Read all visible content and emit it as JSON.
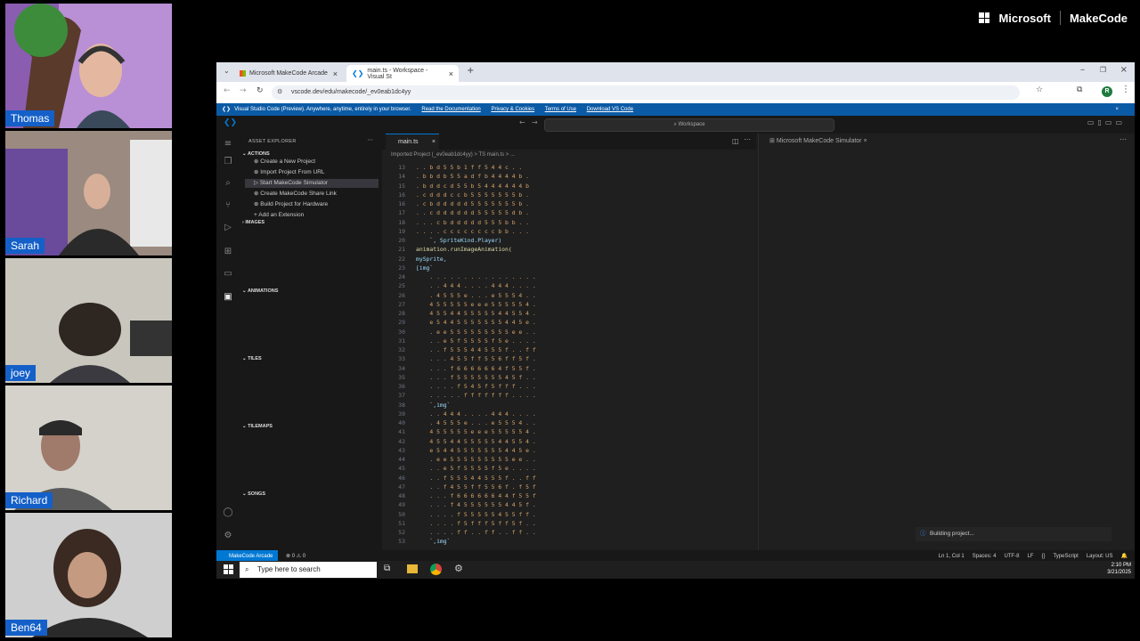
{
  "participants": [
    {
      "name": "Thomas"
    },
    {
      "name": "Sarah"
    },
    {
      "name": "joey"
    },
    {
      "name": "Richard"
    },
    {
      "name": "Ben64"
    }
  ],
  "brand": {
    "microsoft": "Microsoft",
    "makecode": "MakeCode"
  },
  "browser": {
    "tabs": [
      {
        "label": "Microsoft MakeCode Arcade"
      },
      {
        "label": "main.ts - Workspace - Visual St"
      }
    ],
    "url": "vscode.dev/edu/makecode/_ev0eab1dc4yy",
    "avatar_letter": "R"
  },
  "infobar": {
    "message": "Visual Studio Code (Preview). Anywhere, anytime, entirely in your browser.",
    "links": [
      "Read the Documentation",
      "Privacy & Cookies",
      "Terms of Use",
      "Download VS Code"
    ]
  },
  "vscode": {
    "search": "Workspace",
    "sidebar": {
      "title": "ASSET EXPLORER",
      "actions_header": "ACTIONS",
      "actions": [
        "Create a New Project",
        "Import Project From URL",
        "Start MakeCode Simulator",
        "Create MakeCode Share Link",
        "Build Project for Hardware",
        "Add an Extension"
      ],
      "sections": [
        "IMAGES",
        "ANIMATIONS",
        "TILES",
        "TILEMAPS",
        "SONGS"
      ]
    },
    "editor": {
      "tab": "main.ts",
      "breadcrumb": "Imported Project (_ev0eab1dc4yy)  >  TS main.ts  >  ..."
    },
    "code_lines": [
      {
        "n": "13",
        "t": ". . b d 5 5 b 1 f f 5 4 4 c . .",
        "k": "str"
      },
      {
        "n": "14",
        "t": ". b b d b 5 5 a d f b 4 4 4 4 b .",
        "k": "str"
      },
      {
        "n": "15",
        "t": ". b d d c d 5 5 b 5 4 4 4 4 4 4 b",
        "k": "str"
      },
      {
        "n": "16",
        "t": ". c d d d c c b 5 5 5 5 5 5 5 b .",
        "k": "str"
      },
      {
        "n": "16",
        "t": ". c b d d d d d 5 5 5 5 5 5 5 b .",
        "k": "str"
      },
      {
        "n": "17",
        "t": ". . c d d d d d d 5 5 5 5 5 d b .",
        "k": "str"
      },
      {
        "n": "18",
        "t": ". . . c b d d d d d 5 5 5 b b . .",
        "k": "str"
      },
      {
        "n": "19",
        "t": ". . . . c c c c c c c c b b . . .",
        "k": "str"
      },
      {
        "n": "20",
        "t": "    `, SpriteKind.Player)",
        "k": "ident"
      },
      {
        "n": "21",
        "t": "animation.runImageAnimation(",
        "k": "fn"
      },
      {
        "n": "22",
        "t": "mySprite,",
        "k": "ident"
      },
      {
        "n": "23",
        "t": "[img`",
        "k": "ident"
      },
      {
        "n": "24",
        "t": "    . . . . . . . . . . . . . . . .",
        "k": "str"
      },
      {
        "n": "25",
        "t": "    . . 4 4 4 . . . . 4 4 4 . . . .",
        "k": "str"
      },
      {
        "n": "26",
        "t": "    . 4 5 5 5 e . . . e 5 5 5 4 . .",
        "k": "str"
      },
      {
        "n": "27",
        "t": "    4 5 5 5 5 5 e e e 5 5 5 5 5 4 .",
        "k": "str"
      },
      {
        "n": "28",
        "t": "    4 5 5 4 4 5 5 5 5 5 4 4 5 5 4 .",
        "k": "str"
      },
      {
        "n": "29",
        "t": "    e 5 4 4 5 5 5 5 5 5 5 4 4 5 e .",
        "k": "str"
      },
      {
        "n": "30",
        "t": "    . e e 5 5 5 5 5 5 5 5 5 e e . .",
        "k": "str"
      },
      {
        "n": "31",
        "t": "    . . e 5 f 5 5 5 5 f 5 e . . . .",
        "k": "str"
      },
      {
        "n": "32",
        "t": "    . . f 5 5 5 4 4 5 5 5 f . . f f",
        "k": "str"
      },
      {
        "n": "33",
        "t": "    . . . 4 5 5 f f 5 5 6 f f 5 f .",
        "k": "str"
      },
      {
        "n": "34",
        "t": "    . . . f 6 6 6 6 6 6 4 f 5 5 f .",
        "k": "str"
      },
      {
        "n": "35",
        "t": "    . . . f 5 5 5 5 5 5 5 4 5 f . .",
        "k": "str"
      },
      {
        "n": "36",
        "t": "    . . . . f 5 4 5 f 5 f f f . . .",
        "k": "str"
      },
      {
        "n": "37",
        "t": "    . . . . . f f f f f f f . . . .",
        "k": "str"
      },
      {
        "n": "38",
        "t": "    `,img`",
        "k": "ident"
      },
      {
        "n": "39",
        "t": "    . . 4 4 4 . . . . 4 4 4 . . . .",
        "k": "str"
      },
      {
        "n": "40",
        "t": "    . 4 5 5 5 e . . . e 5 5 5 4 . .",
        "k": "str"
      },
      {
        "n": "41",
        "t": "    4 5 5 5 5 5 e e e 5 5 5 5 5 4 .",
        "k": "str"
      },
      {
        "n": "42",
        "t": "    4 5 5 4 4 5 5 5 5 5 4 4 5 5 4 .",
        "k": "str"
      },
      {
        "n": "43",
        "t": "    e 5 4 4 5 5 5 5 5 5 5 4 4 5 e .",
        "k": "str"
      },
      {
        "n": "44",
        "t": "    . e e 5 5 5 5 5 5 5 5 5 e e . .",
        "k": "str"
      },
      {
        "n": "45",
        "t": "    . . e 5 f 5 5 5 5 f 5 e . . . .",
        "k": "str"
      },
      {
        "n": "46",
        "t": "    . . f 5 5 5 4 4 5 5 5 f . . f f",
        "k": "str"
      },
      {
        "n": "47",
        "t": "    . . f 4 5 5 f f 5 5 6 f . f 5 f",
        "k": "str"
      },
      {
        "n": "48",
        "t": "    . . . f 6 6 6 6 6 6 4 4 f 5 5 f",
        "k": "str"
      },
      {
        "n": "49",
        "t": "    . . . f 4 5 5 5 5 5 5 4 4 5 f .",
        "k": "str"
      },
      {
        "n": "50",
        "t": "    . . . . f 5 5 5 5 5 4 5 5 f f .",
        "k": "str"
      },
      {
        "n": "51",
        "t": "    . . . . f 5 f f f 5 f f 5 f . .",
        "k": "str"
      },
      {
        "n": "52",
        "t": "    . . . . f f . . f f . . f f . .",
        "k": "str"
      },
      {
        "n": "53",
        "t": "    `,img`",
        "k": "ident"
      }
    ],
    "simulator": {
      "tab": "Microsoft MakeCode Simulator",
      "notification": "Building project..."
    },
    "status": {
      "remote": "MakeCode Arcade",
      "problems": "⊗ 0 ⚠ 0",
      "right": [
        "Ln 1, Col 1",
        "Spaces: 4",
        "UTF-8",
        "LF",
        "{}",
        "TypeScript",
        "Layout: US"
      ]
    }
  },
  "taskbar": {
    "search_placeholder": "Type here to search",
    "time": "2:10 PM",
    "date": "3/21/2025"
  },
  "colors": {
    "accent": "#0078d4",
    "infobar": "#0b5aa5",
    "name_tag": "#1460c8",
    "code_string": "#d7a36a"
  }
}
